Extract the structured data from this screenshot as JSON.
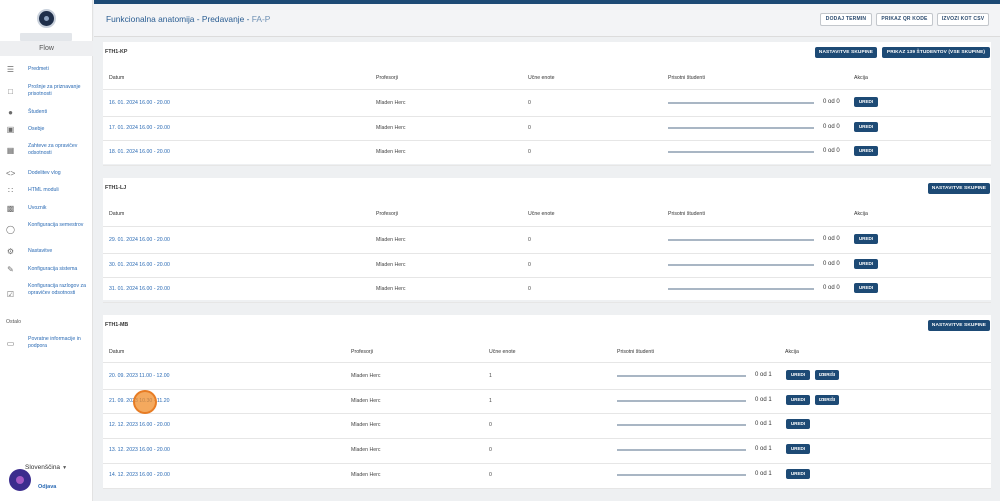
{
  "app": {
    "name": "Flow"
  },
  "sidebar": {
    "items": [
      {
        "label": "Predmeti",
        "icon": "list-icon"
      },
      {
        "label": "Prošnje za priznavanje prisotnosti",
        "icon": "document-icon"
      },
      {
        "label": "Študenti",
        "icon": "people-icon"
      },
      {
        "label": "Osebje",
        "icon": "briefcase-icon"
      },
      {
        "label": "Zahteve za opravičev odsotnosti",
        "icon": "calendar-icon"
      },
      {
        "label": "Dodelitev vlog",
        "icon": "code-icon"
      },
      {
        "label": "HTML moduli",
        "icon": "grid-icon"
      },
      {
        "label": "Uvoznik",
        "icon": "folder-icon"
      },
      {
        "label": "Konfiguracija semestrov",
        "icon": "clock-icon"
      },
      {
        "label": "Nastavitve",
        "icon": "gear-icon"
      },
      {
        "label": "Konfiguracija sistema",
        "icon": "pencil-icon"
      },
      {
        "label": "Konfiguracija razlogov za opravičev odsotnosti",
        "icon": "calendar-check-icon"
      }
    ],
    "section_other": "Ostalo",
    "other_items": [
      {
        "label": "Povratne informacije in podpora",
        "icon": "chat-icon"
      }
    ],
    "language": "Slovenščina",
    "logout": "Odjava"
  },
  "header": {
    "title": "Funkcionalna anatomija - Predavanje - ",
    "code": "FA-P",
    "buttons": {
      "add_term": "DODAJ TERMIN",
      "qr": "PRIKAZ QR KODE",
      "csv": "IZVOZI KOT CSV"
    }
  },
  "columns": {
    "date": "Datum",
    "professors": "Profesorji",
    "units": "Učne enote",
    "present": "Prisotni študenti",
    "action": "Akcija"
  },
  "actions": {
    "edit": "UREDI",
    "delete": "IZBRIŠI",
    "group_settings": "NASTAVITVE SKUPINE",
    "show_all": "PRIKAZ 139 ŠTUDENTOV (VSE SKUPINE)"
  },
  "groups": [
    {
      "name": "FTH1-KP",
      "rows": [
        {
          "date": "16. 01. 2024 16.00 - 20.00",
          "prof": "Mladen Herc",
          "units": "0",
          "count": "0 od 0",
          "fill": 0
        },
        {
          "date": "17. 01. 2024 16.00 - 20.00",
          "prof": "Mladen Herc",
          "units": "0",
          "count": "0 od 0",
          "fill": 0
        },
        {
          "date": "18. 01. 2024 16.00 - 20.00",
          "prof": "Mladen Herc",
          "units": "0",
          "count": "0 od 0",
          "fill": 0
        }
      ]
    },
    {
      "name": "FTH1-LJ",
      "rows": [
        {
          "date": "29. 01. 2024 16.00 - 20.00",
          "prof": "Mladen Herc",
          "units": "0",
          "count": "0 od 0",
          "fill": 0
        },
        {
          "date": "30. 01. 2024 16.00 - 20.00",
          "prof": "Mladen Herc",
          "units": "0",
          "count": "0 od 0",
          "fill": 0
        },
        {
          "date": "31. 01. 2024 16.00 - 20.00",
          "prof": "Mladen Herc",
          "units": "0",
          "count": "0 od 0",
          "fill": 0
        }
      ]
    },
    {
      "name": "FTH1-MB",
      "rows": [
        {
          "date": "20. 09. 2023 11.00 - 12.00",
          "prof": "Mladen Herc",
          "units": "1",
          "count": "0 od 1",
          "fill": 0
        },
        {
          "date": "21. 09. 2023 10.30 - 11.20",
          "prof": "Mladen Herc",
          "units": "1",
          "count": "0 od 1",
          "fill": 0
        },
        {
          "date": "12. 12. 2023 16.00 - 20.00",
          "prof": "Mladen Herc",
          "units": "0",
          "count": "0 od 1",
          "fill": 0
        },
        {
          "date": "13. 12. 2023 16.00 - 20.00",
          "prof": "Mladen Herc",
          "units": "0",
          "count": "0 od 1",
          "fill": 0
        },
        {
          "date": "14. 12. 2023 16.00 - 20.00",
          "prof": "Mladen Herc",
          "units": "0",
          "count": "0 od 1",
          "fill": 0
        }
      ]
    }
  ]
}
